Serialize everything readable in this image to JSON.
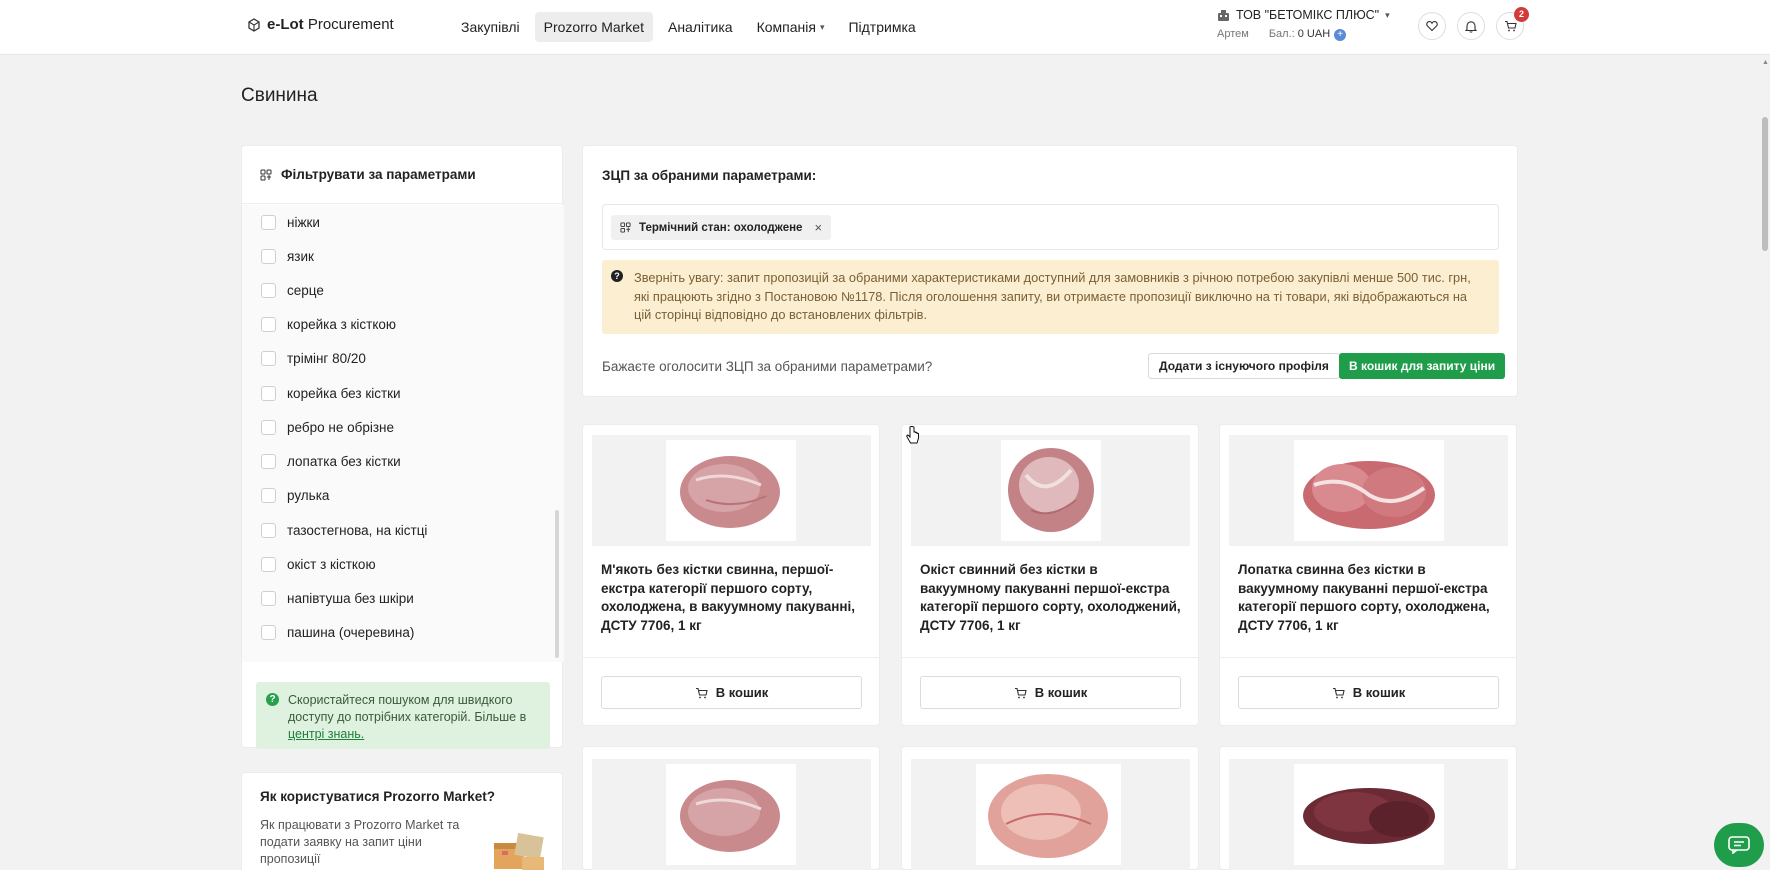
{
  "header": {
    "logo_bold": "e-Lot",
    "logo_rest": "Procurement",
    "nav": [
      {
        "label": "Закупівлі"
      },
      {
        "label": "Prozorro Market"
      },
      {
        "label": "Аналітика"
      },
      {
        "label": "Компанія"
      },
      {
        "label": "Підтримка"
      }
    ],
    "org_name": "ТОВ \"БЕТОМІКС ПЛЮС\"",
    "user": "Артем",
    "balance_label": "Бал.:",
    "balance_value": "0 UAH",
    "cart_count": "2"
  },
  "page": {
    "title": "Свинина"
  },
  "filter": {
    "heading": "Фільтрувати за параметрами",
    "items": [
      "ніжки",
      "язик",
      "серце",
      "корейка з кісткою",
      "трімінг 80/20",
      "корейка без кістки",
      "ребро не обрізне",
      "лопатка без кістки",
      "рулька",
      "тазостегнова, на кістці",
      "окіст з кісткою",
      "напівтуша без шкіри",
      "пашина (очеревина)"
    ],
    "hint_text": "Скористайтеся пошуком для швидкого доступу до потрібних категорій. Більше в",
    "hint_link": "центрі знань."
  },
  "howto": {
    "title": "Як користуватися Prozorro Market?",
    "text": "Як працювати з Prozorro Market та подати заявку на запит ціни пропозиції"
  },
  "zcp": {
    "title": "ЗЦП за обраними параметрами:",
    "chip": "Термічний стан: охолоджене",
    "warning": "Зверніть увагу: запит пропозицій за обраними характеристиками доступний для замовників з річною потребою закупівлі менше 500 тис. грн, які працюють згідно з Постановою №1178. Після оголошення запиту, ви отримаєте пропозиції виключно на ті товари, які відображаються на цій сторінці відповідно до встановлених фільтрів.",
    "question": "Бажаєте оголосити ЗЦП за обраними параметрами?",
    "btn_profile": "Додати з існуючого профіля",
    "btn_cart": "В кошик для запиту ціни"
  },
  "products": [
    {
      "title": "М'якоть без кістки свинна, першої-екстра категорії першого сорту, охолоджена, в вакуумному пакуванні, ДСТУ 7706, 1 кг",
      "cart_label": "В кошик"
    },
    {
      "title": "Окіст свинний без кістки в вакуумному пакуванні першої-екстра категорії першого сорту, охолоджений, ДСТУ 7706, 1 кг",
      "cart_label": "В кошик"
    },
    {
      "title": "Лопатка свинна без кістки в вакуумному пакуванні першої-екстра категорії першого сорту, охолоджена, ДСТУ 7706, 1 кг",
      "cart_label": "В кошик"
    }
  ],
  "colors": {
    "accent_green": "#1f9d4a",
    "warning_bg": "#fbeed1",
    "hint_bg": "#dff1df",
    "badge_red": "#d33a3a"
  }
}
